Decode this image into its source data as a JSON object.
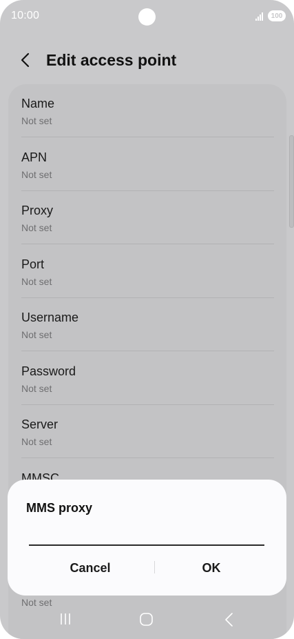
{
  "status_bar": {
    "time": "10:00",
    "battery": "100",
    "icon_color": "#ffffff"
  },
  "header": {
    "back_icon": "chevron-left-icon",
    "title": "Edit access point"
  },
  "settings": [
    {
      "label": "Name",
      "value": "Not set"
    },
    {
      "label": "APN",
      "value": "Not set"
    },
    {
      "label": "Proxy",
      "value": "Not set"
    },
    {
      "label": "Port",
      "value": "Not set"
    },
    {
      "label": "Username",
      "value": "Not set"
    },
    {
      "label": "Password",
      "value": "Not set"
    },
    {
      "label": "Server",
      "value": "Not set"
    },
    {
      "label": "MMSC",
      "value": ""
    },
    {
      "label": "",
      "value": "Not set"
    }
  ],
  "dialog": {
    "title": "MMS proxy",
    "input_value": "",
    "cancel_label": "Cancel",
    "ok_label": "OK"
  },
  "nav_bar": {
    "recents_icon": "recents-icon",
    "home_icon": "home-icon",
    "back_icon": "back-icon"
  },
  "colors": {
    "scrim_background": "#c9c9cb",
    "card_background": "#c3c3c5",
    "dialog_background": "#fbfbfd"
  }
}
